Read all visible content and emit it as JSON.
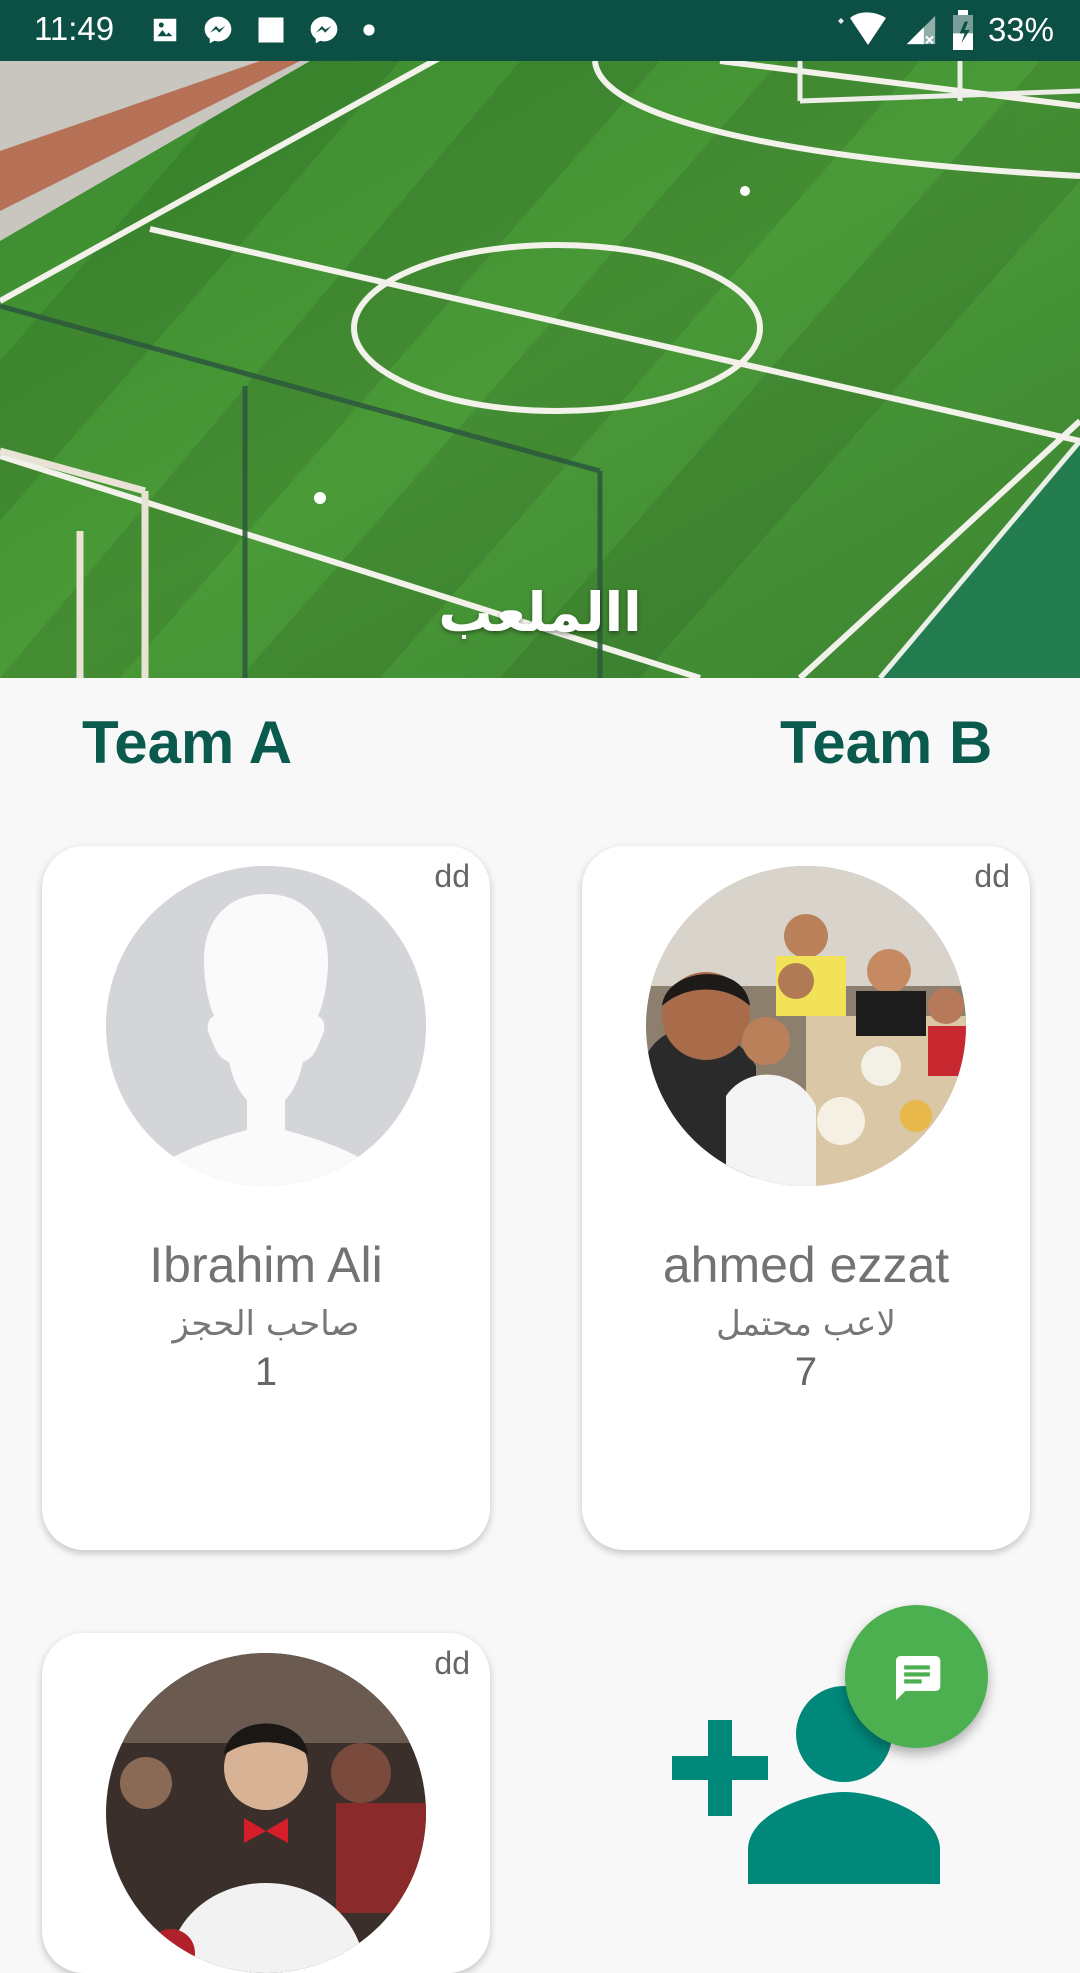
{
  "status_bar": {
    "time": "11:49",
    "battery_percent": "33%",
    "notification_icons": [
      "image-icon",
      "messenger-icon",
      "square-icon",
      "messenger-icon",
      "dot-icon"
    ],
    "status_icons": [
      "wifi-icon",
      "signal-icon",
      "battery-icon"
    ]
  },
  "header": {
    "title": "االملعب"
  },
  "teams": {
    "team_a_label": "Team A",
    "team_b_label": "Team B"
  },
  "players": [
    {
      "rating": "dd",
      "name": "Ibrahim Ali",
      "role": "صاحب الحجز",
      "number": "1"
    },
    {
      "rating": "dd",
      "name": "ahmed ezzat",
      "role": "لاعب محتمل",
      "number": "7"
    },
    {
      "rating": "dd"
    }
  ],
  "colors": {
    "status_bar": "#0b4f45",
    "team_heading": "#0b5a4e",
    "fab": "#4caf50",
    "add_player_icon": "#00897b"
  }
}
